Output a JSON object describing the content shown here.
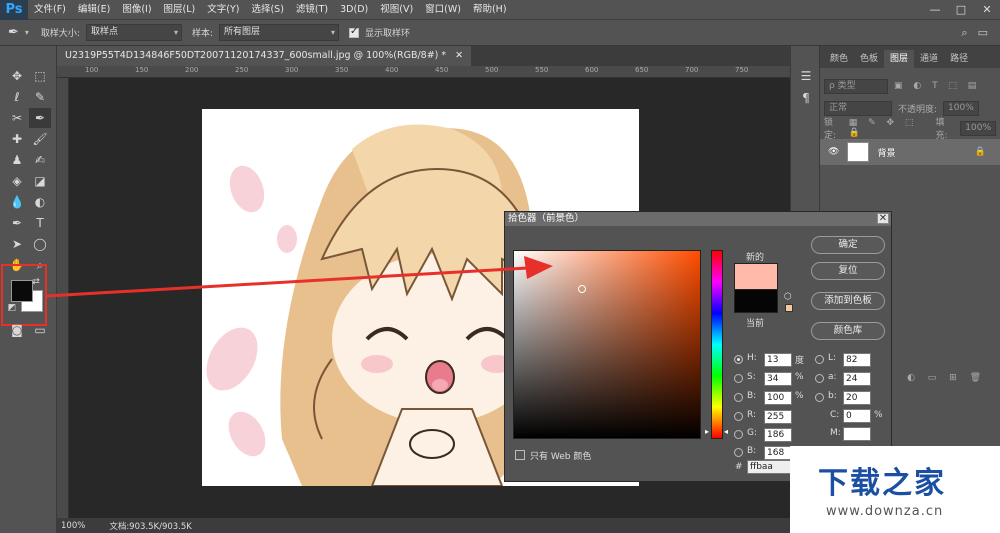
{
  "app": {
    "logo": "Ps",
    "menus": [
      "文件(F)",
      "编辑(E)",
      "图像(I)",
      "图层(L)",
      "文字(Y)",
      "选择(S)",
      "滤镜(T)",
      "3D(D)",
      "视图(V)",
      "窗口(W)",
      "帮助(H)"
    ],
    "window_controls": [
      "—",
      "□",
      "✕"
    ]
  },
  "options": {
    "sample_size_label": "取样大小:",
    "sample_size_value": "取样点",
    "sample_label": "样本:",
    "sample_value": "所有图层",
    "show_ring_label": "显示取样环",
    "show_ring_checked": true
  },
  "document": {
    "tab_title": "U2319P55T4D134846F50DT20071120174337_600small.jpg @ 100%(RGB/8#) *",
    "zoom": "100%",
    "doc_size": "文档:903.5K/903.5K",
    "ruler_ticks": [
      "100",
      "150",
      "200",
      "250",
      "300",
      "350",
      "400",
      "450",
      "500",
      "550",
      "600",
      "650",
      "700",
      "750"
    ]
  },
  "panels": {
    "tabs": [
      "颜色",
      "色板",
      "图层",
      "通道",
      "路径"
    ],
    "active_tab": "图层",
    "kind_label": "ρ 类型",
    "blend_mode": "正常",
    "opacity_label": "不透明度:",
    "opacity_value": "100%",
    "lock_label": "锁定:",
    "fill_label": "填充:",
    "fill_value": "100%",
    "layer_name": "背景"
  },
  "color_picker": {
    "title": "拾色器（前景色）",
    "new_label": "新的",
    "current_label": "当前",
    "buttons": {
      "ok": "确定",
      "reset": "复位",
      "add_swatch": "添加到色板",
      "library": "颜色库"
    },
    "web_only_label": "只有 Web 颜色",
    "new_color": "#ffbaaa",
    "current_color": "#050505",
    "fields": {
      "H": "13",
      "S": "34",
      "B": "100",
      "R": "255",
      "G": "186",
      "Bv": "168",
      "L": "82",
      "a": "24",
      "b": "20",
      "C": "0",
      "M": "",
      "hex_prefix": "#",
      "hex": "ffbaa"
    },
    "units": {
      "deg": "度",
      "pct": "%"
    }
  },
  "watermark": {
    "text": "下载之家",
    "url": "www.downza.cn"
  }
}
